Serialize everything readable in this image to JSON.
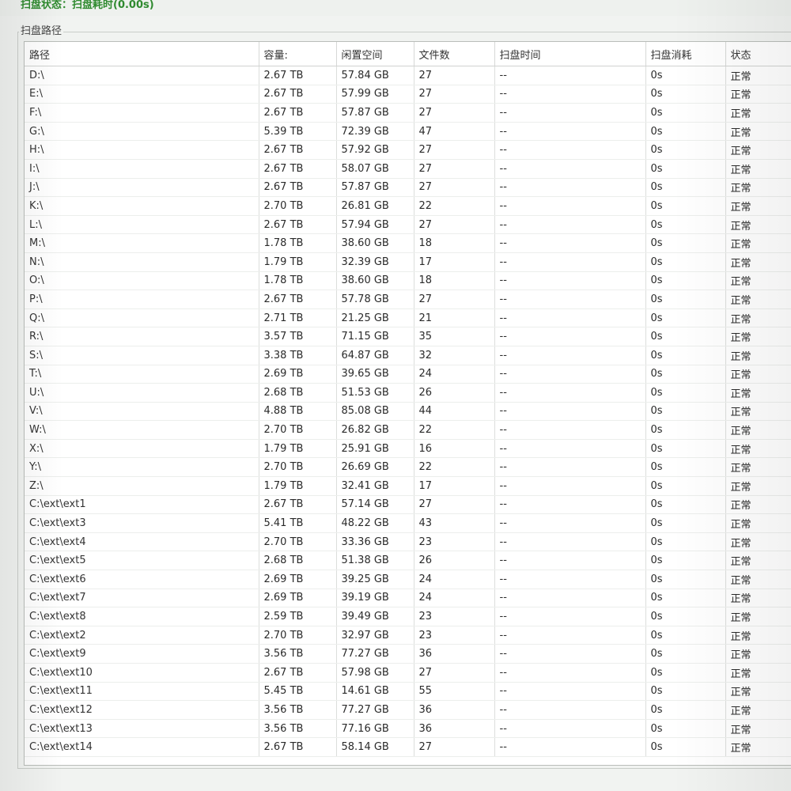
{
  "status": {
    "text": "扫盘状态：扫盘耗时(0.00s)"
  },
  "group": {
    "title": "扫盘路径"
  },
  "columns": [
    "路径",
    "容量:",
    "闲置空间",
    "文件数",
    "扫盘时间",
    "扫盘消耗",
    "状态"
  ],
  "rows": [
    [
      "D:\\",
      "2.67 TB",
      "57.84 GB",
      "27",
      "--",
      "0s",
      "正常"
    ],
    [
      "E:\\",
      "2.67 TB",
      "57.99 GB",
      "27",
      "--",
      "0s",
      "正常"
    ],
    [
      "F:\\",
      "2.67 TB",
      "57.87 GB",
      "27",
      "--",
      "0s",
      "正常"
    ],
    [
      "G:\\",
      "5.39 TB",
      "72.39 GB",
      "47",
      "--",
      "0s",
      "正常"
    ],
    [
      "H:\\",
      "2.67 TB",
      "57.92 GB",
      "27",
      "--",
      "0s",
      "正常"
    ],
    [
      "I:\\",
      "2.67 TB",
      "58.07 GB",
      "27",
      "--",
      "0s",
      "正常"
    ],
    [
      "J:\\",
      "2.67 TB",
      "57.87 GB",
      "27",
      "--",
      "0s",
      "正常"
    ],
    [
      "K:\\",
      "2.70 TB",
      "26.81 GB",
      "22",
      "--",
      "0s",
      "正常"
    ],
    [
      "L:\\",
      "2.67 TB",
      "57.94 GB",
      "27",
      "--",
      "0s",
      "正常"
    ],
    [
      "M:\\",
      "1.78 TB",
      "38.60 GB",
      "18",
      "--",
      "0s",
      "正常"
    ],
    [
      "N:\\",
      "1.79 TB",
      "32.39 GB",
      "17",
      "--",
      "0s",
      "正常"
    ],
    [
      "O:\\",
      "1.78 TB",
      "38.60 GB",
      "18",
      "--",
      "0s",
      "正常"
    ],
    [
      "P:\\",
      "2.67 TB",
      "57.78 GB",
      "27",
      "--",
      "0s",
      "正常"
    ],
    [
      "Q:\\",
      "2.71 TB",
      "21.25 GB",
      "21",
      "--",
      "0s",
      "正常"
    ],
    [
      "R:\\",
      "3.57 TB",
      "71.15 GB",
      "35",
      "--",
      "0s",
      "正常"
    ],
    [
      "S:\\",
      "3.38 TB",
      "64.87 GB",
      "32",
      "--",
      "0s",
      "正常"
    ],
    [
      "T:\\",
      "2.69 TB",
      "39.65 GB",
      "24",
      "--",
      "0s",
      "正常"
    ],
    [
      "U:\\",
      "2.68 TB",
      "51.53 GB",
      "26",
      "--",
      "0s",
      "正常"
    ],
    [
      "V:\\",
      "4.88 TB",
      "85.08 GB",
      "44",
      "--",
      "0s",
      "正常"
    ],
    [
      "W:\\",
      "2.70 TB",
      "26.82 GB",
      "22",
      "--",
      "0s",
      "正常"
    ],
    [
      "X:\\",
      "1.79 TB",
      "25.91 GB",
      "16",
      "--",
      "0s",
      "正常"
    ],
    [
      "Y:\\",
      "2.70 TB",
      "26.69 GB",
      "22",
      "--",
      "0s",
      "正常"
    ],
    [
      "Z:\\",
      "1.79 TB",
      "32.41 GB",
      "17",
      "--",
      "0s",
      "正常"
    ],
    [
      "C:\\ext\\ext1",
      "2.67 TB",
      "57.14 GB",
      "27",
      "--",
      "0s",
      "正常"
    ],
    [
      "C:\\ext\\ext3",
      "5.41 TB",
      "48.22 GB",
      "43",
      "--",
      "0s",
      "正常"
    ],
    [
      "C:\\ext\\ext4",
      "2.70 TB",
      "33.36 GB",
      "23",
      "--",
      "0s",
      "正常"
    ],
    [
      "C:\\ext\\ext5",
      "2.68 TB",
      "51.38 GB",
      "26",
      "--",
      "0s",
      "正常"
    ],
    [
      "C:\\ext\\ext6",
      "2.69 TB",
      "39.25 GB",
      "24",
      "--",
      "0s",
      "正常"
    ],
    [
      "C:\\ext\\ext7",
      "2.69 TB",
      "39.19 GB",
      "24",
      "--",
      "0s",
      "正常"
    ],
    [
      "C:\\ext\\ext8",
      "2.59 TB",
      "39.49 GB",
      "23",
      "--",
      "0s",
      "正常"
    ],
    [
      "C:\\ext\\ext2",
      "2.70 TB",
      "32.97 GB",
      "23",
      "--",
      "0s",
      "正常"
    ],
    [
      "C:\\ext\\ext9",
      "3.56 TB",
      "77.27 GB",
      "36",
      "--",
      "0s",
      "正常"
    ],
    [
      "C:\\ext\\ext10",
      "2.67 TB",
      "57.98 GB",
      "27",
      "--",
      "0s",
      "正常"
    ],
    [
      "C:\\ext\\ext11",
      "5.45 TB",
      "14.61 GB",
      "55",
      "--",
      "0s",
      "正常"
    ],
    [
      "C:\\ext\\ext12",
      "3.56 TB",
      "77.27 GB",
      "36",
      "--",
      "0s",
      "正常"
    ],
    [
      "C:\\ext\\ext13",
      "3.56 TB",
      "77.16 GB",
      "36",
      "--",
      "0s",
      "正常"
    ],
    [
      "C:\\ext\\ext14",
      "2.67 TB",
      "58.14 GB",
      "27",
      "--",
      "0s",
      "正常"
    ]
  ]
}
